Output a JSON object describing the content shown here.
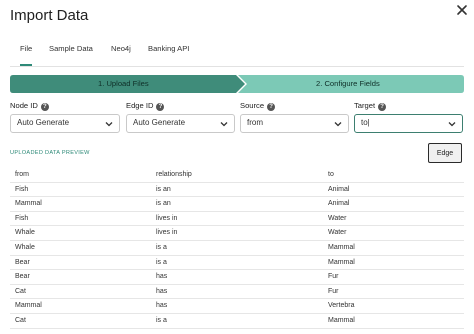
{
  "dialog": {
    "title": "Import Data"
  },
  "tabs": [
    {
      "label": "File",
      "active": true
    },
    {
      "label": "Sample Data",
      "active": false
    },
    {
      "label": "Neo4j",
      "active": false
    },
    {
      "label": "Banking API",
      "active": false
    }
  ],
  "stepper": {
    "steps": [
      {
        "label": "1. Upload Files",
        "state": "complete"
      },
      {
        "label": "2. Configure Fields",
        "state": "current"
      }
    ],
    "colors": {
      "complete": "#3f8c7a",
      "current": "#7cc9b6"
    }
  },
  "fields": {
    "node_id": {
      "label": "Node ID",
      "value": "Auto Generate"
    },
    "edge_id": {
      "label": "Edge ID",
      "value": "Auto Generate"
    },
    "source": {
      "label": "Source",
      "value": "from"
    },
    "target": {
      "label": "Target",
      "value": "to|"
    }
  },
  "preview": {
    "heading": "UPLOADED DATA PREVIEW",
    "edge_button": "Edge",
    "columns": [
      "from",
      "relationship",
      "to"
    ],
    "rows": [
      [
        "Fish",
        "is an",
        "Animal"
      ],
      [
        "Mammal",
        "is an",
        "Animal"
      ],
      [
        "Fish",
        "lives in",
        "Water"
      ],
      [
        "Whale",
        "lives in",
        "Water"
      ],
      [
        "Whale",
        "is a",
        "Mammal"
      ],
      [
        "Bear",
        "is a",
        "Mammal"
      ],
      [
        "Bear",
        "has",
        "Fur"
      ],
      [
        "Cat",
        "has",
        "Fur"
      ],
      [
        "Mammal",
        "has",
        "Vertebra"
      ],
      [
        "Cat",
        "is a",
        "Mammal"
      ]
    ]
  },
  "icons": {
    "close": "close-icon",
    "help": "help-icon",
    "dropdown": "chevron-down-icon"
  }
}
